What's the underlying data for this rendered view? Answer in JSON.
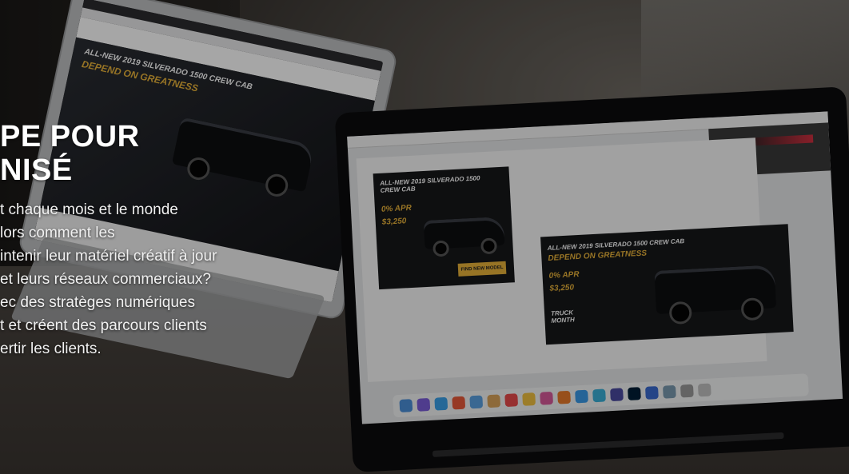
{
  "overlay": {
    "heading_lines": [
      "PE POUR",
      "NISÉ"
    ],
    "body_lines": [
      "t chaque mois et le monde",
      "lors comment les",
      "intenir leur matériel créatif à jour",
      "et leurs réseaux commerciaux?",
      "ec des stratèges numériques",
      "t et créent des parcours clients",
      "ertir les clients."
    ]
  },
  "left_laptop": {
    "ad_headline": "ALL-NEW 2019 SILVERADO 1500 CREW CAB",
    "ad_tagline": "DEPEND ON GREATNESS"
  },
  "right_laptop": {
    "ad_small": {
      "headline": "ALL-NEW 2019 SILVERADO 1500 CREW CAB",
      "apr": "0% APR",
      "cash": "$3,250",
      "button": "FIND NEW MODEL"
    },
    "ad_large": {
      "headline": "ALL-NEW 2019 SILVERADO 1500 CREW CAB",
      "tagline": "DEPEND ON GREATNESS",
      "apr": "0% APR",
      "cash": "$3,250",
      "brand": "TRUCK MONTH"
    }
  },
  "colors": {
    "accent_gold": "#e8b23a",
    "overlay_text": "#ffffff"
  }
}
